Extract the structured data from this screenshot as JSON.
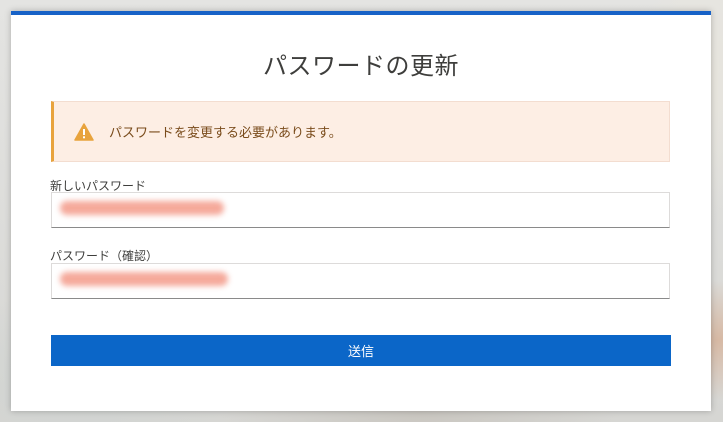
{
  "dialog": {
    "title": "パスワードの更新",
    "accent_color": "#1762c7"
  },
  "alert": {
    "icon": "warning-icon",
    "message": "パスワードを変更する必要があります。",
    "color": "#e8a33d"
  },
  "form": {
    "new_password": {
      "label": "新しいパスワード",
      "value": "••••••••••••••••••••"
    },
    "confirm_password": {
      "label": "パスワード（確認）",
      "value": "••••••••••••••••••••"
    },
    "submit_label": "送信",
    "submit_color": "#0b66c8"
  }
}
